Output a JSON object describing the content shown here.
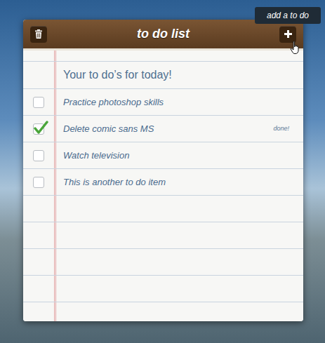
{
  "window": {
    "title": "to do list"
  },
  "tooltip": {
    "text": "add a to do"
  },
  "heading": "Your to do’s for today!",
  "items": [
    {
      "text": "Practice photoshop skills",
      "checked": false
    },
    {
      "text": "Delete comic sans MS",
      "checked": true,
      "status": "done!"
    },
    {
      "text": "Watch television",
      "checked": false
    },
    {
      "text": "This is another to do item",
      "checked": false
    }
  ]
}
